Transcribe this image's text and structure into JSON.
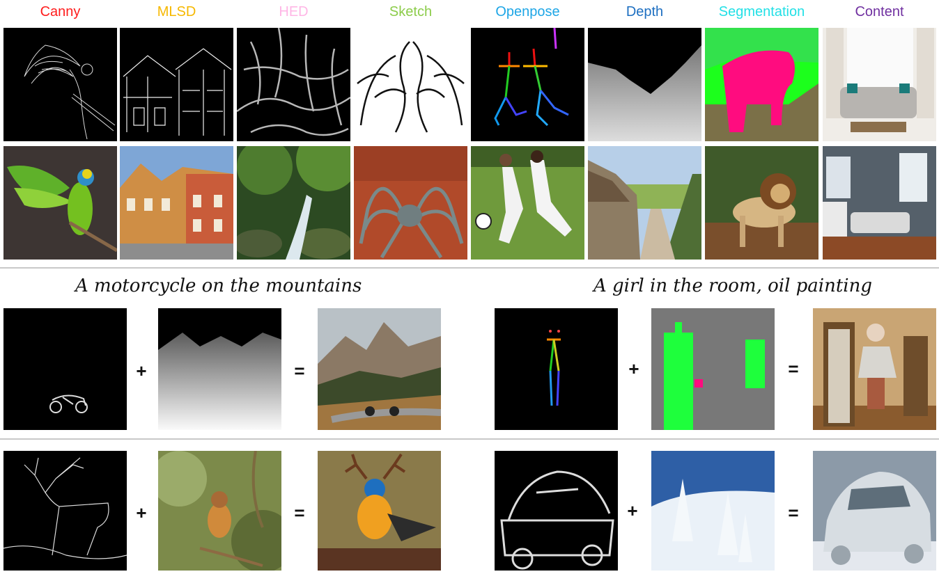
{
  "columns": [
    {
      "label": "Canny",
      "color": "#ff1c1c"
    },
    {
      "label": "MLSD",
      "color": "#f6b800"
    },
    {
      "label": "HED",
      "color": "#ffb6e6"
    },
    {
      "label": "Sketch",
      "color": "#8ccc4a"
    },
    {
      "label": "Openpose",
      "color": "#1ea6e6"
    },
    {
      "label": "Depth",
      "color": "#1d6fc1"
    },
    {
      "label": "Segmentation",
      "color": "#22e0e6"
    },
    {
      "label": "Content",
      "color": "#7030a0"
    }
  ],
  "row1_conditions": [
    "canny-parrot-edges",
    "mlsd-building-lines",
    "hed-tree-branches",
    "sketch-spider",
    "openpose-skeletons",
    "depth-village-street",
    "segmentation-lion",
    "content-living-room"
  ],
  "row2_outputs": [
    "parrot",
    "townhouses",
    "forest-waterfall",
    "robot-spider",
    "soccer-players",
    "village-street",
    "lion",
    "living-room"
  ],
  "compositions": [
    {
      "prompt": "A motorcycle on the mountains",
      "inputs": [
        "motorcycle-canny",
        "mountain-depth"
      ],
      "output": "motorcycle-mountains"
    },
    {
      "prompt": "A girl in the room, oil painting",
      "inputs": [
        "girl-openpose",
        "room-segmentation"
      ],
      "output": "girl-oil-painting"
    },
    {
      "prompt": "",
      "inputs": [
        "deer-canny",
        "robin-content"
      ],
      "output": "antlered-bird"
    },
    {
      "prompt": "",
      "inputs": [
        "car-hed",
        "snow-content"
      ],
      "output": "snow-car"
    }
  ],
  "operators": {
    "plus": "+",
    "equals": "="
  }
}
